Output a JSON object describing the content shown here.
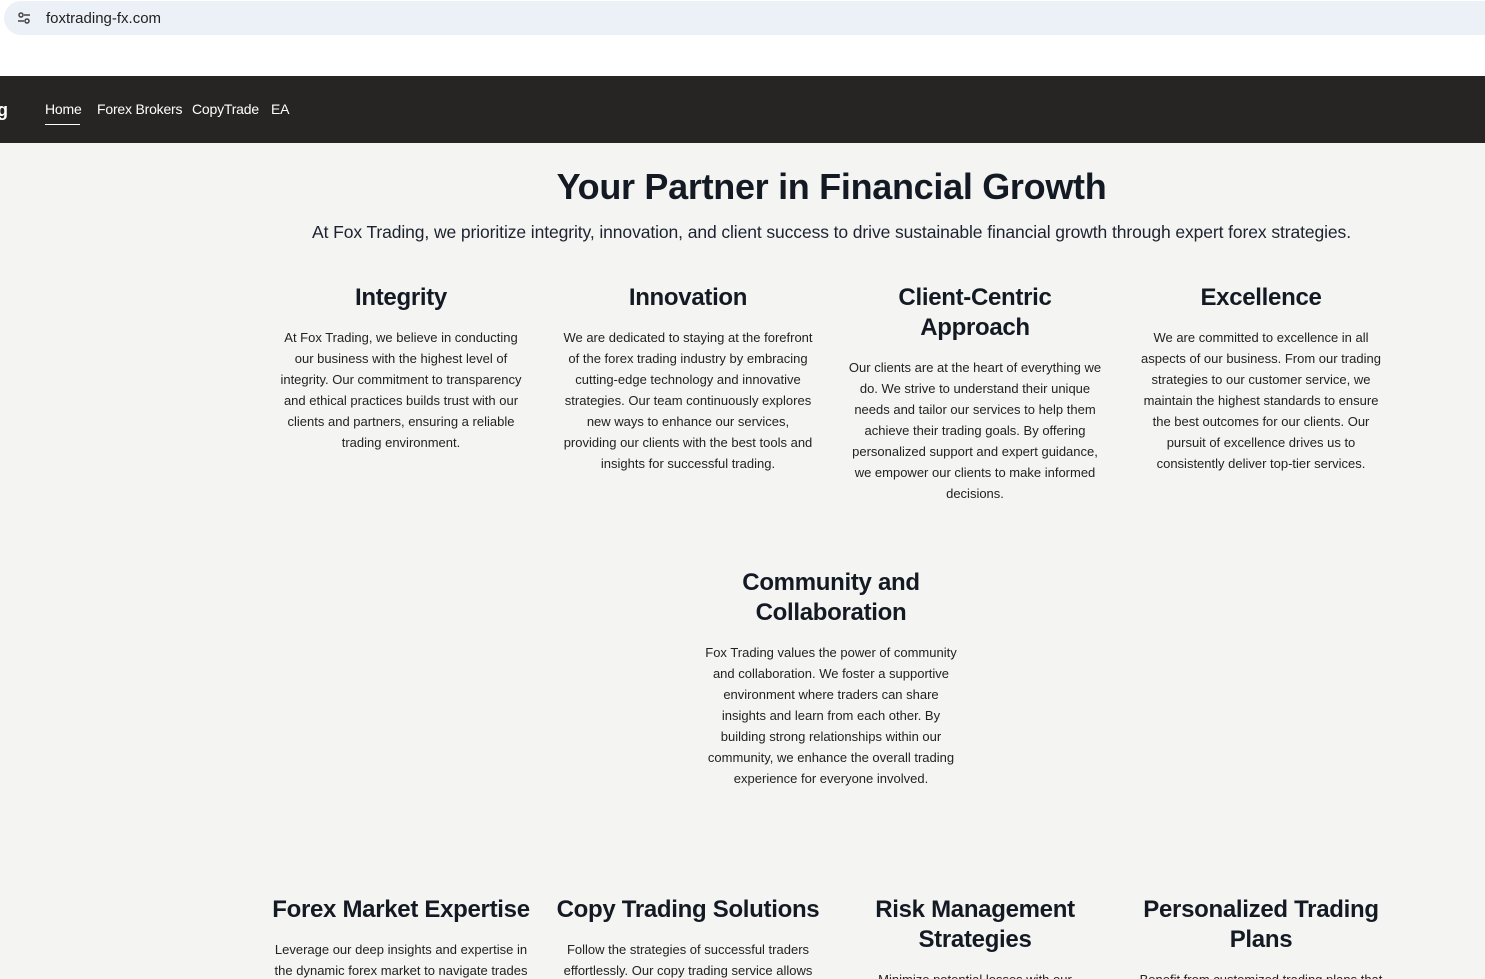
{
  "browser": {
    "url": "foxtrading-fx.com",
    "site_icon": "tune-icon"
  },
  "nav": {
    "brand_fragment": "g",
    "items": [
      {
        "label": "Home",
        "active": true
      },
      {
        "label": "Forex Brokers"
      },
      {
        "label": "CopyTrade"
      },
      {
        "label": "EA"
      }
    ]
  },
  "hero": {
    "title": "Your Partner in Financial Growth",
    "subtitle": "At Fox Trading, we prioritize integrity, innovation, and client success to drive sustainable financial growth through expert forex strategies."
  },
  "values": [
    {
      "title": "Integrity",
      "text": "At Fox Trading, we believe in conducting our business with the highest level of integrity. Our commitment to transparency and ethical practices builds trust with our clients and partners, ensuring a reliable trading environment."
    },
    {
      "title": "Innovation",
      "text": "We are dedicated to staying at the forefront of the forex trading industry by embracing cutting-edge technology and innovative strategies. Our team continuously explores new ways to enhance our services, providing our clients with the best tools and insights for successful trading."
    },
    {
      "title": "Client-Centric Approach",
      "text": "Our clients are at the heart of everything we do. We strive to understand their unique needs and tailor our services to help them achieve their trading goals. By offering personalized support and expert guidance, we empower our clients to make informed decisions."
    },
    {
      "title": "Excellence",
      "text": "We are committed to excellence in all aspects of our business. From our trading strategies to our customer service, we maintain the highest standards to ensure the best outcomes for our clients. Our pursuit of excellence drives us to consistently deliver top-tier services."
    },
    {
      "title": "Community and Collaboration",
      "text": "Fox Trading values the power of community and collaboration. We foster a supportive environment where traders can share insights and learn from each other. By building strong relationships within our community, we enhance the overall trading experience for everyone involved."
    }
  ],
  "services": [
    {
      "title": "Forex Market Expertise",
      "text": "Leverage our deep insights and expertise in the dynamic forex market to navigate trades"
    },
    {
      "title": "Copy Trading Solutions",
      "text": "Follow the strategies of successful traders effortlessly. Our copy trading service allows"
    },
    {
      "title": "Risk Management Strategies",
      "text": "Minimize potential losses with our"
    },
    {
      "title": "Personalized Trading Plans",
      "text": "Benefit from customized trading plans that"
    }
  ]
}
